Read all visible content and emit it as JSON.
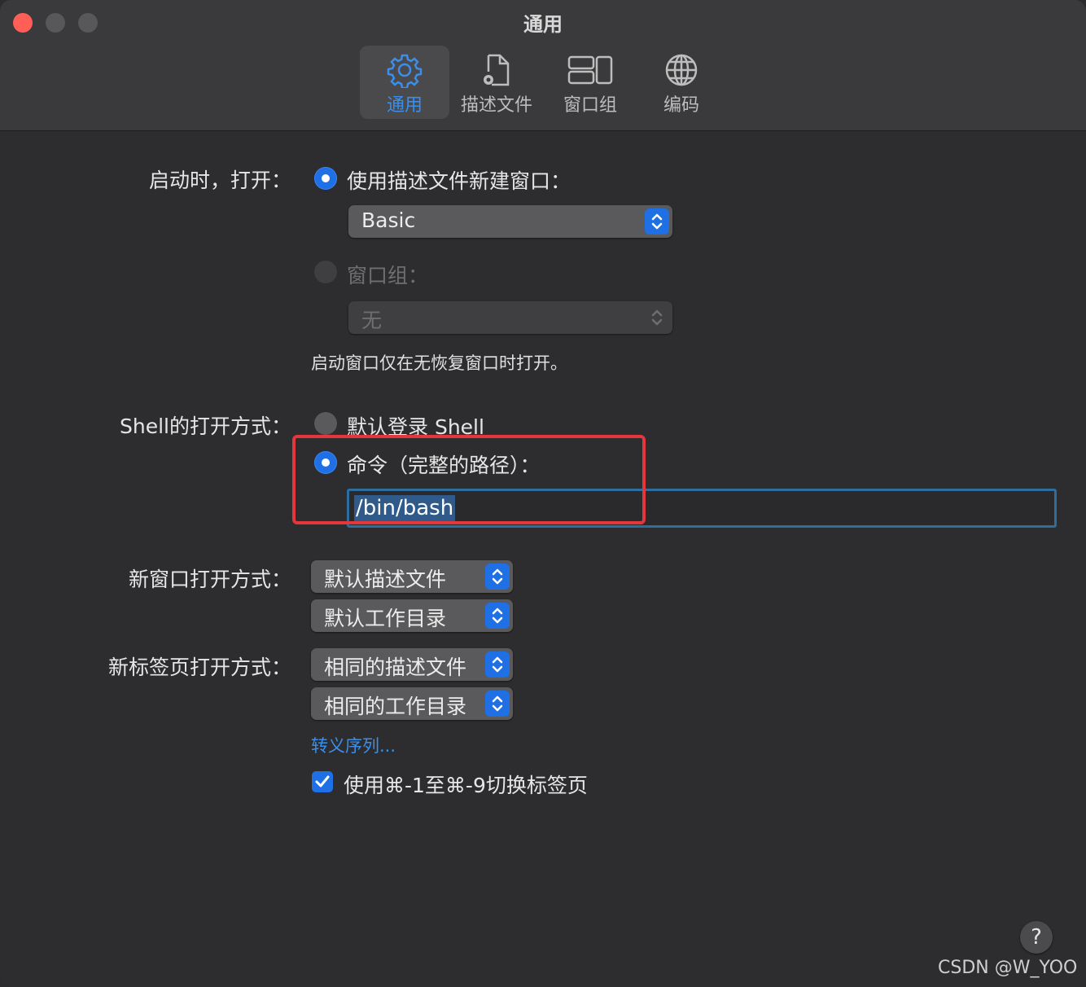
{
  "window": {
    "title": "通用"
  },
  "tabs": [
    {
      "label": "通用",
      "icon": "gear-icon",
      "active": true
    },
    {
      "label": "描述文件",
      "icon": "profile-document-icon",
      "active": false
    },
    {
      "label": "窗口组",
      "icon": "window-groups-icon",
      "active": false
    },
    {
      "label": "编码",
      "icon": "globe-icon",
      "active": false
    }
  ],
  "startup": {
    "label": "启动时，打开：",
    "option_profile": "使用描述文件新建窗口：",
    "profile_value": "Basic",
    "option_group": "窗口组：",
    "group_value": "无",
    "hint": "启动窗口仅在无恢复窗口时打开。"
  },
  "shell": {
    "label": "Shell的打开方式：",
    "option_default": "默认登录 Shell",
    "option_command": "命令（完整的路径）：",
    "command_value": "/bin/bash"
  },
  "new_window": {
    "label": "新窗口打开方式：",
    "profile_value": "默认描述文件",
    "dir_value": "默认工作目录"
  },
  "new_tab": {
    "label": "新标签页打开方式：",
    "profile_value": "相同的描述文件",
    "dir_value": "相同的工作目录"
  },
  "escape_link": "转义序列...",
  "tab_switch_checkbox": {
    "label": "使用⌘-1至⌘-9切换标签页",
    "checked": true
  },
  "help_label": "?",
  "watermark": "CSDN @W_YOO",
  "colors": {
    "accent": "#1f6fe5",
    "highlight_box": "#e5363b",
    "link": "#3b8eea"
  }
}
